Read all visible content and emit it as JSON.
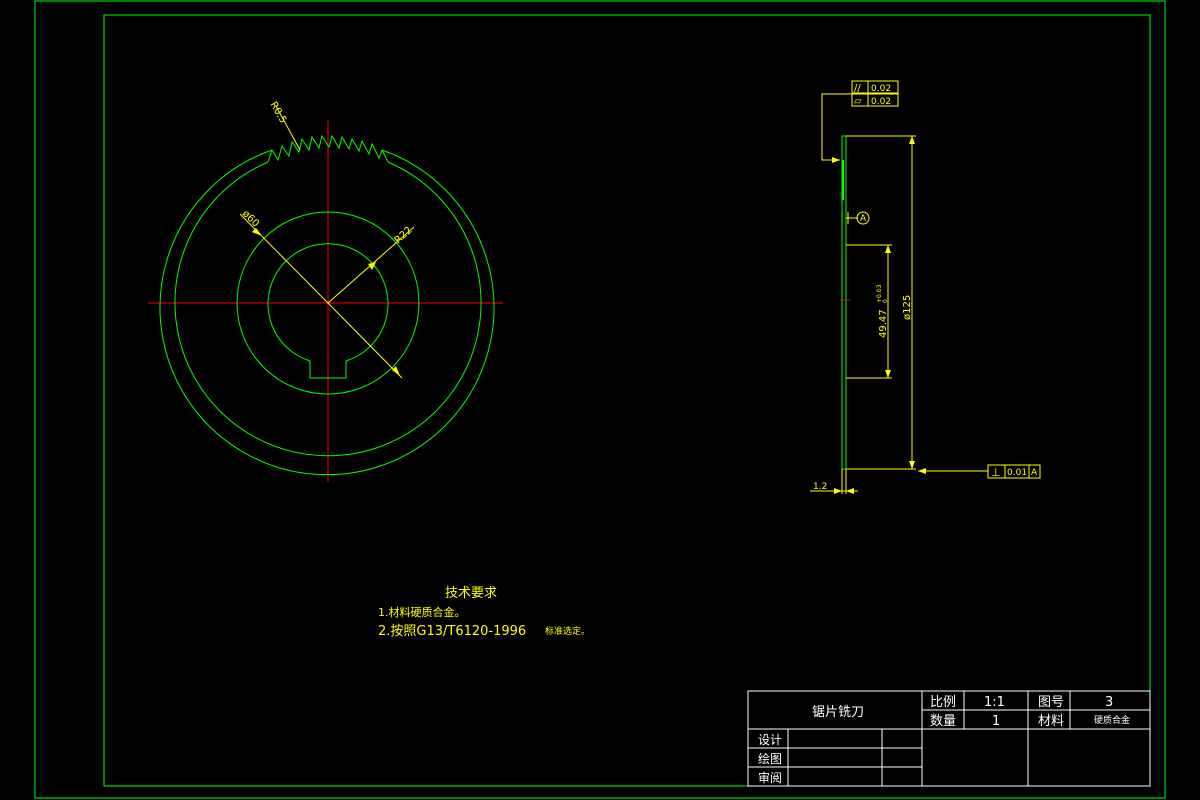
{
  "colors": {
    "background": "#000000",
    "outline": "#00ff00",
    "centerline": "#ff0000",
    "dimension": "#ffff00",
    "text": "#ffff00",
    "frame": "#00ff00"
  },
  "front_view": {
    "dim_tooth_radius": "R0.5",
    "dim_inner_diameter": "ø60",
    "dim_bore_radius": "R22"
  },
  "side_view": {
    "tolerance_parallel": {
      "symbol": "//",
      "value": "0.02"
    },
    "tolerance_flatness": {
      "symbol": "⏥",
      "value": "0.02"
    },
    "datum_label": "A",
    "dim_bore": "49.47",
    "dim_bore_tol_upper": "+0.03",
    "dim_bore_tol_lower": "0",
    "dim_outer_diameter": "ø125",
    "dim_thickness": "1.2",
    "tolerance_perpendicular": {
      "symbol": "⊥",
      "value": "0.01",
      "datum": "A"
    }
  },
  "tech_requirements": {
    "title": "技术要求",
    "item1": "1.材料硬质合金。",
    "item2_prefix": "2.按照G13/T6120-1996",
    "item2_suffix": "标准选定。"
  },
  "title_block": {
    "part_name": "锯片铣刀",
    "scale_label": "比例",
    "scale_value": "1:1",
    "drawing_no_label": "图号",
    "drawing_no_value": "3",
    "quantity_label": "数量",
    "quantity_value": "1",
    "material_label": "材料",
    "material_value": "硬质合金",
    "design_label": "设计",
    "drawn_label": "绘图",
    "review_label": "审阅"
  }
}
